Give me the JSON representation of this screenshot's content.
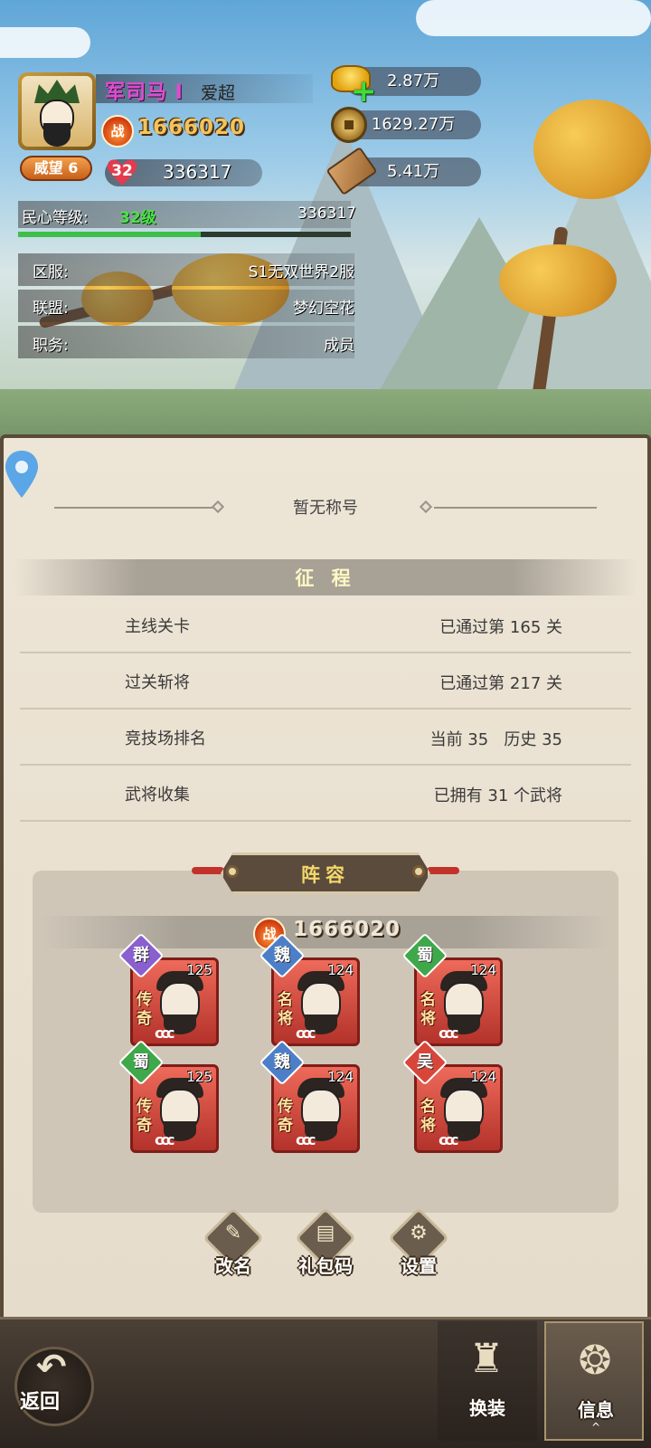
{
  "player": {
    "rank": "军司马 Ⅰ",
    "name": "爱超",
    "power_icon": "战",
    "power": "1666020",
    "prestige": "威望 6",
    "heart_level": "32",
    "heart_value": "336317"
  },
  "currencies": [
    {
      "icon": "gold-ingot-icon",
      "value": "2.87万"
    },
    {
      "icon": "copper-coin-icon",
      "value": "1629.27万"
    },
    {
      "icon": "wood-icon",
      "value": "5.41万"
    }
  ],
  "loyalty": {
    "label": "民心等级:",
    "level": "32级",
    "value": "336317",
    "progress": 0.55
  },
  "info_rows": [
    {
      "label": "区服:",
      "value": "S1无双世界2服"
    },
    {
      "label": "联盟:",
      "value": "梦幻空花"
    },
    {
      "label": "职务:",
      "value": "成员"
    }
  ],
  "title_section": {
    "text": "暂无称号"
  },
  "journey": {
    "heading": "征 程",
    "rows": [
      {
        "label": "主线关卡",
        "value": "已通过第 165 关"
      },
      {
        "label": "过关斩将",
        "value": "已通过第 217 关"
      },
      {
        "label": "竞技场排名",
        "value": "当前 35   历史 35"
      },
      {
        "label": "武将收集",
        "value": "已拥有 31 个武将"
      }
    ]
  },
  "lineup": {
    "heading": "阵容",
    "power_icon": "战",
    "power": "1666020",
    "heroes": [
      {
        "faction": "群",
        "faction_color": "#8a5fd0",
        "rarity": "传奇",
        "level": "125",
        "waves": "ccc"
      },
      {
        "faction": "魏",
        "faction_color": "#4d7fc8",
        "rarity": "名将",
        "level": "124",
        "waves": "ccc"
      },
      {
        "faction": "蜀",
        "faction_color": "#3fa84a",
        "rarity": "名将",
        "level": "124",
        "waves": "ccc"
      },
      {
        "faction": "蜀",
        "faction_color": "#3fa84a",
        "rarity": "传奇",
        "level": "125",
        "waves": "ccc"
      },
      {
        "faction": "魏",
        "faction_color": "#4d7fc8",
        "rarity": "传奇",
        "level": "124",
        "waves": "ccc"
      },
      {
        "faction": "吴",
        "faction_color": "#d8463a",
        "rarity": "名将",
        "level": "124",
        "waves": "ccc"
      }
    ]
  },
  "actions": [
    {
      "label": "改名",
      "icon": "pencil-icon",
      "glyph": "✎"
    },
    {
      "label": "礼包码",
      "icon": "gift-code-icon",
      "glyph": "▤"
    },
    {
      "label": "设置",
      "icon": "wrench-icon",
      "glyph": "⚙"
    }
  ],
  "bottom_bar": {
    "back_label": "返回",
    "tabs": [
      {
        "label": "换装",
        "icon": "robe-icon",
        "glyph": "♜"
      },
      {
        "label": "信息",
        "icon": "dragon-icon",
        "glyph": "❂",
        "caret": "^"
      }
    ]
  },
  "colors": {
    "accent_gold": "#f3c45a",
    "rank_purple": "#e14bd2",
    "loyalty_green": "#4ee04a",
    "panel_paper": "#ede5d6"
  }
}
